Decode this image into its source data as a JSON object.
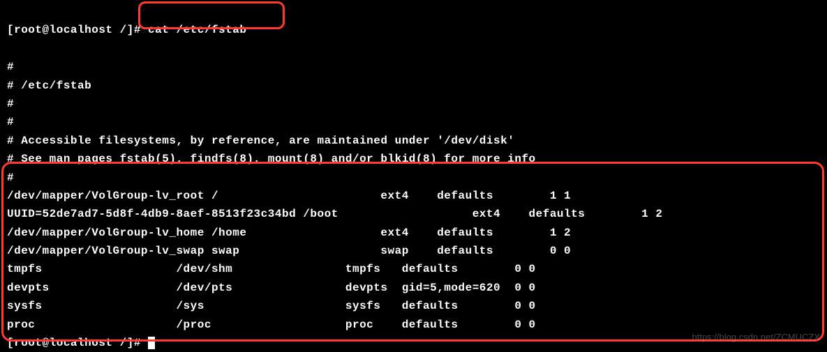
{
  "prompt1": "[root@localhost /]# ",
  "command1": "cat /etc/fstab",
  "output_lines": [
    "",
    "#",
    "# /etc/fstab",
    "#",
    "#",
    "# Accessible filesystems, by reference, are maintained under '/dev/disk'",
    "# See man pages fstab(5), findfs(8), mount(8) and/or blkid(8) for more info",
    "#",
    "/dev/mapper/VolGroup-lv_root /                       ext4    defaults        1 1",
    "UUID=52de7ad7-5d8f-4db9-8aef-8513f23c34bd /boot                   ext4    defaults        1 2",
    "/dev/mapper/VolGroup-lv_home /home                   ext4    defaults        1 2",
    "/dev/mapper/VolGroup-lv_swap swap                    swap    defaults        0 0",
    "tmpfs                   /dev/shm                tmpfs   defaults        0 0",
    "devpts                  /dev/pts                devpts  gid=5,mode=620  0 0",
    "sysfs                   /sys                    sysfs   defaults        0 0",
    "proc                    /proc                   proc    defaults        0 0"
  ],
  "prompt2": "[root@localhost /]# ",
  "watermark": "https://blog.csdn.net/ZCMUCZX"
}
